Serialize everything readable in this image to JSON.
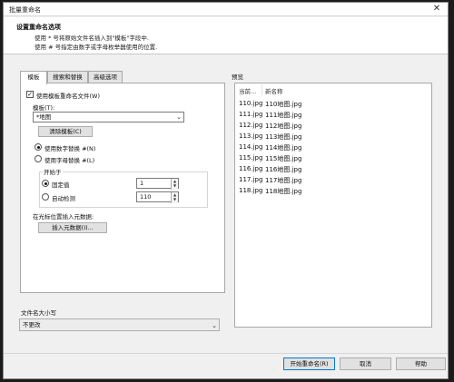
{
  "window": {
    "title": "批量重命名",
    "close_glyph": "✕"
  },
  "header": {
    "title": "设置重命名选项",
    "line1": "使用 * 号将原始文件名插入到\"模板\"字段中.",
    "line2": "使用 # 号指定由数字或字母枚举器使用的位置."
  },
  "tabs": [
    {
      "label": "模板"
    },
    {
      "label": "搜索和替换"
    },
    {
      "label": "高级选项"
    }
  ],
  "template_tab": {
    "use_template_label": "使用模板重命名文件(W)",
    "use_template_checked": true,
    "template_label": "模板(T):",
    "template_value": "*地图",
    "clear_template_button": "清除模板(C)",
    "numeric_replace_label": "使用数字替换 #(N)",
    "letter_replace_label": "使用字母替换 #(L)",
    "start_group_label": "开始于",
    "fixed_value_label": "固定值",
    "fixed_value": "1",
    "auto_detect_label": "自动检测",
    "auto_detect_value": "110",
    "insert_meta_caption": "在光标位置插入元数据:",
    "insert_meta_button": "插入元数据(I)..."
  },
  "filename_case": {
    "label": "文件名大小写",
    "value": "不更改"
  },
  "preview": {
    "label": "预览",
    "columns": [
      "当前...",
      "新名称"
    ],
    "rows": [
      {
        "current": "110.jpg",
        "new": "110地图.jpg"
      },
      {
        "current": "111.jpg",
        "new": "111地图.jpg"
      },
      {
        "current": "112.jpg",
        "new": "112地图.jpg"
      },
      {
        "current": "113.jpg",
        "new": "113地图.jpg"
      },
      {
        "current": "114.jpg",
        "new": "114地图.jpg"
      },
      {
        "current": "115.jpg",
        "new": "115地图.jpg"
      },
      {
        "current": "116.jpg",
        "new": "116地图.jpg"
      },
      {
        "current": "117.jpg",
        "new": "117地图.jpg"
      },
      {
        "current": "118.jpg",
        "new": "118地图.jpg"
      }
    ]
  },
  "footer": {
    "start_button": "开始重命名(R)",
    "cancel_button": "取消",
    "help_button": "帮助"
  },
  "icons": {
    "checkbox_checked": "check-icon",
    "dropdown": "chevron-down-icon",
    "spin": "spin-arrows-icon"
  }
}
